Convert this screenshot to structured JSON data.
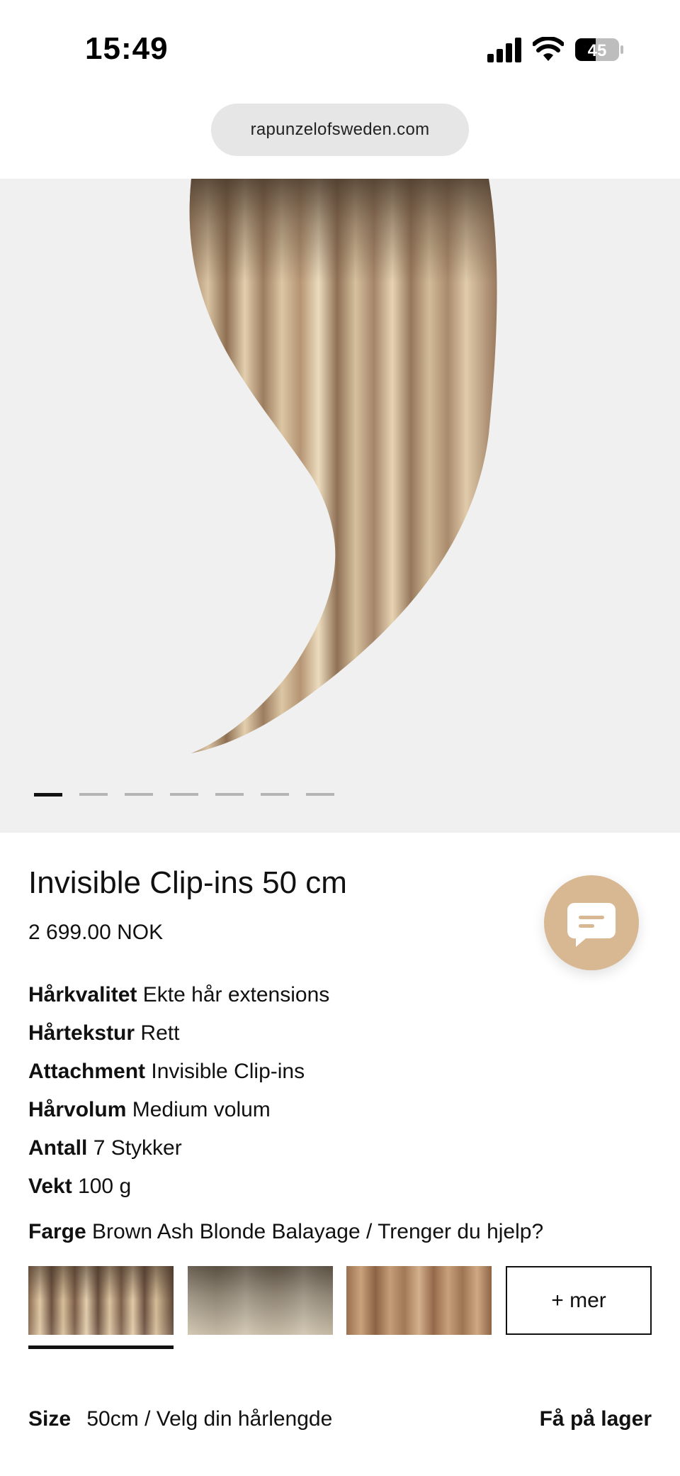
{
  "status_bar": {
    "time": "15:49",
    "battery": "45",
    "icons": [
      "cellular-signal-icon",
      "wifi-icon",
      "battery-icon"
    ]
  },
  "browser": {
    "url": "rapunzelofsweden.com"
  },
  "gallery": {
    "image": "hair-extension-photo",
    "total_slides": 7,
    "active_slide": 1
  },
  "product": {
    "title": "Invisible Clip-ins 50 cm",
    "price": "2 699.00 NOK",
    "attributes": [
      {
        "label": "Hårkvalitet",
        "value": "Ekte hår extensions"
      },
      {
        "label": "Hårtekstur",
        "value": "Rett"
      },
      {
        "label": "Attachment",
        "value": "Invisible Clip-ins"
      },
      {
        "label": "Hårvolum",
        "value": "Medium volum"
      },
      {
        "label": "Antall",
        "value": "7 Stykker"
      },
      {
        "label": "Vekt",
        "value": "100 g"
      }
    ],
    "color": {
      "label": "Farge",
      "value": "Brown Ash Blonde Balayage / Trenger du hjelp?"
    },
    "swatches": [
      {
        "name": "Brown Ash Blonde Balayage",
        "selected": true
      },
      {
        "name": "color-swatch-2",
        "selected": false
      },
      {
        "name": "color-swatch-3",
        "selected": false
      }
    ],
    "more_label": "+ mer",
    "size": {
      "label": "Size",
      "value": "50cm / Velg din hårlengde",
      "stock": "Få på lager"
    }
  },
  "chat": {
    "icon": "chat-bubble-icon"
  },
  "colors": {
    "chat_button": "#d8b892",
    "image_background": "#f0f0f0",
    "url_pill": "#e6e6e6"
  }
}
